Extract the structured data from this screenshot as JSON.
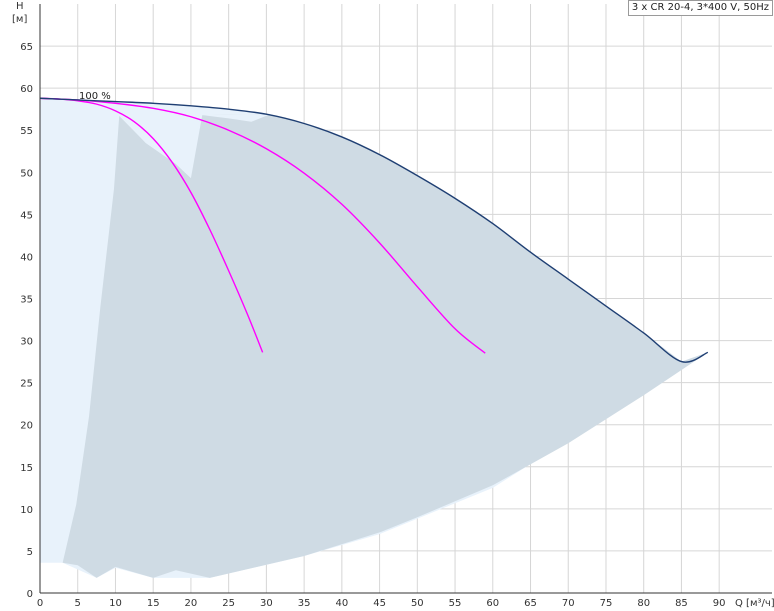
{
  "legend": "3 x CR 20-4, 3*400 V, 50Hz",
  "chart_data": {
    "type": "line",
    "title": "",
    "xlabel": "Q [м³/ч]",
    "ylabel_top": "H",
    "ylabel_unit": "[м]",
    "xlim": [
      0,
      97
    ],
    "ylim": [
      0,
      70
    ],
    "x_ticks": [
      0,
      5,
      10,
      15,
      20,
      25,
      30,
      35,
      40,
      45,
      50,
      55,
      60,
      65,
      70,
      75,
      80,
      85,
      90
    ],
    "y_ticks": [
      0,
      5,
      10,
      15,
      20,
      25,
      30,
      35,
      40,
      45,
      50,
      55,
      60,
      65
    ],
    "grid": true,
    "speed_label": "100 %",
    "colors": {
      "main_curve": "#1f3f73",
      "pump_curves": "#ff00ff",
      "region_light": "#e8f2fb",
      "region_dark": "#cfdbe4",
      "grid": "#d6d6d6"
    },
    "series": [
      {
        "role": "total",
        "x": [
          0,
          5,
          10,
          15,
          20,
          25,
          30,
          35,
          40,
          45,
          50,
          55,
          60,
          65,
          70,
          75,
          80,
          85,
          88.5
        ],
        "y": [
          58.8,
          58.6,
          58.4,
          58.2,
          57.9,
          57.5,
          56.9,
          55.8,
          54.2,
          52.1,
          49.6,
          46.9,
          43.9,
          40.5,
          37.3,
          34.1,
          30.9,
          27.5,
          28.6
        ]
      },
      {
        "role": "two_pumps",
        "x": [
          0,
          5,
          10,
          15,
          20,
          25,
          30,
          35,
          40,
          45,
          50,
          55,
          59
        ],
        "y": [
          58.8,
          58.6,
          58.2,
          57.6,
          56.6,
          55.0,
          52.8,
          49.9,
          46.2,
          41.6,
          36.4,
          31.4,
          28.5
        ]
      },
      {
        "role": "one_pump",
        "x": [
          0,
          2.5,
          5,
          7.5,
          10,
          12.5,
          15,
          17.5,
          20,
          22.5,
          25,
          27.5,
          29.5
        ],
        "y": [
          58.8,
          58.7,
          58.5,
          58.1,
          57.3,
          56.0,
          54.0,
          51.2,
          47.6,
          43.2,
          38.3,
          33.1,
          28.6
        ]
      }
    ],
    "regions": [
      {
        "role": "light",
        "x": [
          0,
          7,
          12,
          17,
          22,
          26,
          30,
          40,
          40,
          40,
          88.5
        ],
        "y": [
          58.8,
          58.4,
          58.2,
          57.9,
          57.6,
          57.3,
          56.9,
          56.9,
          56.9,
          56.9,
          28.6
        ]
      }
    ]
  }
}
